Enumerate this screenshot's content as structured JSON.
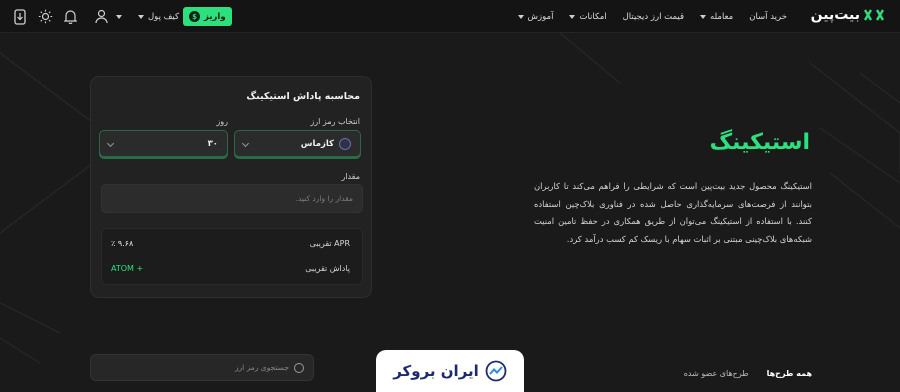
{
  "header": {
    "logo_text": "بیت‌پین",
    "nav": [
      {
        "label": "خرید آسان",
        "has_caret": false
      },
      {
        "label": "معامله",
        "has_caret": true
      },
      {
        "label": "قیمت ارز دیجیتال",
        "has_caret": false
      },
      {
        "label": "امکانات",
        "has_caret": true
      },
      {
        "label": "آموزش",
        "has_caret": true
      }
    ],
    "deposit_label": "واریز",
    "wallet_label": "کیف پول",
    "accent_color": "#2ee07d"
  },
  "calculator": {
    "title": "محاسبه پاداش استیکینگ",
    "currency_label": "انتخاب رمز ارز",
    "currency_value": "کازماس",
    "day_label": "روز",
    "day_value": "۳۰",
    "amount_label": "مقدار",
    "amount_placeholder": "مقدار را وارد کنید.",
    "apr_label": "APR تقریبی",
    "apr_value": "٪ ۹.۶۸",
    "reward_label": "پاداش تقریبی",
    "reward_value": "ATOM +"
  },
  "hero": {
    "title": "استیکینگ",
    "description": "استیکینگ محصول جدید بیت‌پین است که شرایطی را فراهم می‌کند تا کاربران بتوانند از فرصت‌های سرمایه‌گذاری حاصل شده در فناوری بلاک‌چین استفاده کنند. با استفاده از استیکینگ می‌توان از طریق همکاری در حفظ تامین امنیت شبکه‌های بلاک‌چینی مبتنی بر اثبات سهام با ریسک کم کسب درآمد کرد."
  },
  "plans": {
    "search_placeholder": "جستجوی رمز ارز",
    "tabs": [
      "همه طرح‌ها",
      "طرح‌های عضو شده"
    ]
  },
  "watermark": {
    "text": "ایران بروکر"
  }
}
